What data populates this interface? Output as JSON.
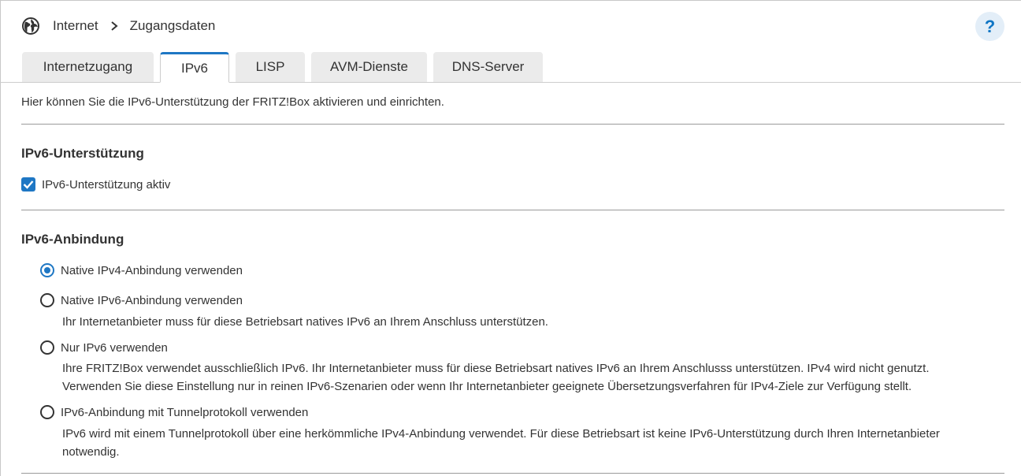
{
  "breadcrumb": {
    "section": "Internet",
    "page": "Zugangsdaten"
  },
  "help": {
    "label": "?"
  },
  "tabs": [
    {
      "label": "Internetzugang",
      "active": false
    },
    {
      "label": "IPv6",
      "active": true
    },
    {
      "label": "LISP",
      "active": false
    },
    {
      "label": "AVM-Dienste",
      "active": false
    },
    {
      "label": "DNS-Server",
      "active": false
    }
  ],
  "intro": "Hier können Sie die IPv6-Unterstützung der FRITZ!Box aktivieren und einrichten.",
  "support": {
    "heading": "IPv6-Unterstützung",
    "checkbox_label": "IPv6-Unterstützung aktiv",
    "checked": true
  },
  "connection": {
    "heading": "IPv6-Anbindung",
    "options": [
      {
        "label": "Native IPv4-Anbindung verwenden",
        "selected": true,
        "desc": []
      },
      {
        "label": "Native IPv6-Anbindung verwenden",
        "selected": false,
        "desc": [
          "Ihr Internetanbieter muss für diese Betriebsart natives IPv6 an Ihrem Anschluss unterstützen."
        ]
      },
      {
        "label": "Nur IPv6 verwenden",
        "selected": false,
        "desc": [
          "Ihre FRITZ!Box verwendet ausschließlich IPv6. Ihr Internetanbieter muss für diese Betriebsart natives IPv6 an Ihrem Anschlusss unterstützen. IPv4 wird nicht genutzt.",
          "Verwenden Sie diese Einstellung nur in reinen IPv6-Szenarien oder wenn Ihr Internetanbieter geeignete Übersetzungsverfahren für IPv4-Ziele zur Verfügung stellt."
        ]
      },
      {
        "label": "IPv6-Anbindung mit Tunnelprotokoll verwenden",
        "selected": false,
        "desc": [
          "IPv6 wird mit einem Tunnelprotokoll über eine herkömmliche IPv4-Anbindung verwendet. Für diese Betriebsart ist keine IPv6-Unterstützung durch Ihren Internetanbieter",
          "notwendig."
        ]
      }
    ]
  },
  "colors": {
    "accent": "#1e77c4",
    "help_bg": "#e3eef8",
    "tab_bg": "#ebebeb",
    "text": "#333333"
  },
  "icons": {
    "header": "globe-icon",
    "separator": "chevron-right-icon",
    "checkbox": "checkmark-icon"
  }
}
